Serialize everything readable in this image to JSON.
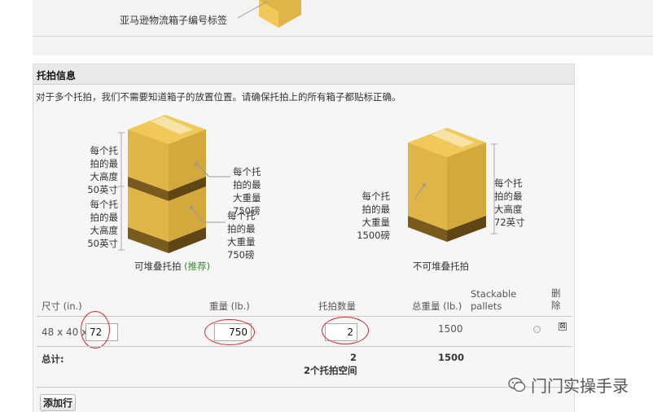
{
  "top": {
    "label_text": "亚马逊物流箱子编号标签"
  },
  "panel": {
    "title": "托拍信息",
    "intro": "对于多个托拍，我们不需要知道箱子的放置位置。请确保托拍上的所有箱子都贴标正确。"
  },
  "stackable": {
    "height_upper": "每个托\n拍的最\n大高度\n50英寸",
    "height_lower": "每个托\n拍的最\n大高度\n50英寸",
    "weight_upper": "每个托\n拍的最\n大重量\n750磅",
    "weight_lower": "每个托\n拍的最\n大重量\n750磅",
    "caption": "可堆叠托拍",
    "recommend": "(推荐)"
  },
  "non_stackable": {
    "weight": "每个托\n拍的最\n大重量\n1500磅",
    "height": "每个托\n拍的最\n大高度\n72英寸",
    "caption": "不可堆叠托拍"
  },
  "table": {
    "headers": {
      "dimensions": "尺寸 (in.)",
      "weight": "重量 (lb.)",
      "pallet_count": "托拍数量",
      "total_weight": "总重量 (lb.)",
      "stackable": "Stackable\npallets",
      "delete": "删\n除"
    },
    "row": {
      "dimensions_prefix": "48 x 40 x",
      "height_value": "72",
      "weight_value": "750",
      "count_value": "2",
      "total_weight": "1500",
      "delete_symbol": "⊠"
    },
    "totals": {
      "label": "总计:",
      "count": "2",
      "space": "2个托拍空间",
      "weight": "1500"
    },
    "add_row": "添加行"
  },
  "watermark": {
    "text": "门门实操手录"
  },
  "colors": {
    "box_light": "#f0c95a",
    "box_mid": "#e0b547",
    "box_dark": "#c99d33",
    "pallet": "#7a5b1e",
    "tape": "#f7e3a6",
    "highlight_ring": "#d9262a",
    "recommend_green": "#3a8a3a"
  }
}
